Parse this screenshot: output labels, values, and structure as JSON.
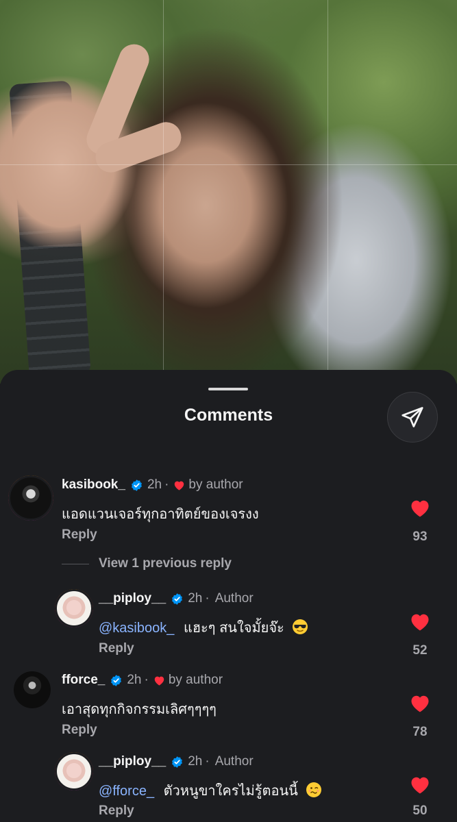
{
  "sheet": {
    "title": "Comments"
  },
  "comments": [
    {
      "username": "kasibook_",
      "time": "2h",
      "separator": "·",
      "liked_tag": "by author",
      "text": "แอดแวนเจอร์ทุกอาทิตย์ของเจรงง",
      "reply_label": "Reply",
      "likes": "93",
      "avatar": "man-portrait-avatar"
    },
    {
      "username": "__piploy__",
      "time": "2h",
      "separator": "·",
      "author_tag": "Author",
      "mention": "@kasibook_",
      "text": "แฮะๆ สนใจมั้ยจ๊ะ",
      "emoji": "sunglasses-emoji",
      "reply_label": "Reply",
      "likes": "52",
      "avatar": "cartoon-girl-avatar"
    },
    {
      "username": "fforce_",
      "time": "2h",
      "separator": "·",
      "liked_tag": "by author",
      "text": "เอาสุดทุกกิจกรรมเลิศๆๆๆๆ",
      "reply_label": "Reply",
      "likes": "78",
      "avatar": "man-dark-avatar"
    },
    {
      "username": "__piploy__",
      "time": "2h",
      "separator": "·",
      "author_tag": "Author",
      "mention": "@fforce_",
      "text": "ตัวหนูขาใครไม่รู้ตอนนี้",
      "emoji": "woozy-face-emoji",
      "reply_label": "Reply",
      "likes": "50",
      "avatar": "cartoon-girl-avatar"
    }
  ],
  "view_replies": {
    "label": "View 1 previous reply"
  },
  "colors": {
    "background": "#1c1d20",
    "heart": "#ff3040",
    "verified": "#0095f6",
    "mention": "#8ab4ff",
    "muted": "#a8a8ad"
  }
}
